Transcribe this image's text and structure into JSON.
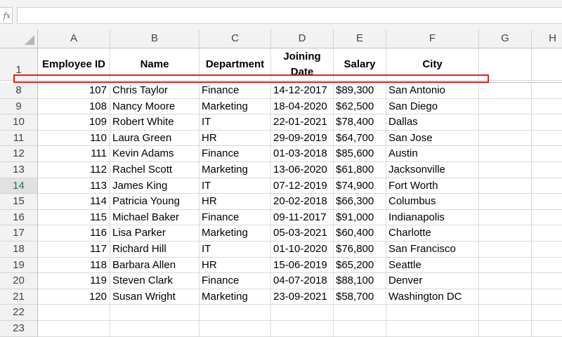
{
  "formula_bar": {
    "fx_label": "fx",
    "value": ""
  },
  "columns": [
    "A",
    "B",
    "C",
    "D",
    "E",
    "F",
    "G",
    "H"
  ],
  "header_row": {
    "row_number": "1",
    "cells": [
      "Employee ID",
      "Name",
      "Department",
      "Joining Date",
      "Salary",
      "City"
    ]
  },
  "rows": [
    {
      "row": "8",
      "id": "107",
      "name": "Chris Taylor",
      "dept": "Finance",
      "date": "14-12-2017",
      "salary": "$89,300",
      "city": "San Antonio"
    },
    {
      "row": "9",
      "id": "108",
      "name": "Nancy Moore",
      "dept": "Marketing",
      "date": "18-04-2020",
      "salary": "$62,500",
      "city": "San Diego"
    },
    {
      "row": "10",
      "id": "109",
      "name": "Robert White",
      "dept": "IT",
      "date": "22-01-2021",
      "salary": "$78,400",
      "city": "Dallas"
    },
    {
      "row": "11",
      "id": "110",
      "name": "Laura Green",
      "dept": "HR",
      "date": "29-09-2019",
      "salary": "$64,700",
      "city": "San Jose"
    },
    {
      "row": "12",
      "id": "111",
      "name": "Kevin Adams",
      "dept": "Finance",
      "date": "01-03-2018",
      "salary": "$85,600",
      "city": "Austin"
    },
    {
      "row": "13",
      "id": "112",
      "name": "Rachel Scott",
      "dept": "Marketing",
      "date": "13-06-2020",
      "salary": "$61,800",
      "city": "Jacksonville"
    },
    {
      "row": "14",
      "id": "113",
      "name": "James King",
      "dept": "IT",
      "date": "07-12-2019",
      "salary": "$74,900",
      "city": "Fort Worth"
    },
    {
      "row": "15",
      "id": "114",
      "name": "Patricia Young",
      "dept": "HR",
      "date": "20-02-2018",
      "salary": "$66,300",
      "city": "Columbus"
    },
    {
      "row": "16",
      "id": "115",
      "name": "Michael Baker",
      "dept": "Finance",
      "date": "09-11-2017",
      "salary": "$91,000",
      "city": "Indianapolis"
    },
    {
      "row": "17",
      "id": "116",
      "name": "Lisa Parker",
      "dept": "Marketing",
      "date": "05-03-2021",
      "salary": "$60,400",
      "city": "Charlotte"
    },
    {
      "row": "18",
      "id": "117",
      "name": "Richard Hill",
      "dept": "IT",
      "date": "01-10-2020",
      "salary": "$76,800",
      "city": "San Francisco"
    },
    {
      "row": "19",
      "id": "118",
      "name": "Barbara Allen",
      "dept": "HR",
      "date": "15-06-2019",
      "salary": "$65,200",
      "city": "Seattle"
    },
    {
      "row": "20",
      "id": "119",
      "name": "Steven Clark",
      "dept": "Finance",
      "date": "04-07-2018",
      "salary": "$88,100",
      "city": "Denver"
    },
    {
      "row": "21",
      "id": "120",
      "name": "Susan Wright",
      "dept": "Marketing",
      "date": "23-09-2021",
      "salary": "$58,700",
      "city": "Washington DC"
    }
  ],
  "empty_rows": [
    "22",
    "23"
  ],
  "selected_row": "14",
  "colors": {
    "annotation": "#e0231e",
    "selected_row_header": "#217346"
  }
}
